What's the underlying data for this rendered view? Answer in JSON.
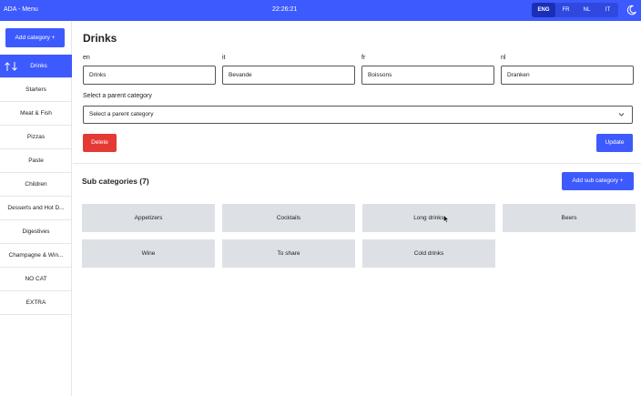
{
  "header": {
    "app_title": "ADA - Menu",
    "clock": "22:26:21",
    "languages": [
      "ENG",
      "FR",
      "NL",
      "IT"
    ],
    "active_language": "ENG",
    "theme_icon": "moon-icon"
  },
  "sidebar": {
    "add_label": "Add category +",
    "items": [
      {
        "label": "Drinks"
      },
      {
        "label": "Starters"
      },
      {
        "label": "Meat & Fish"
      },
      {
        "label": "Pizzas"
      },
      {
        "label": "Paste"
      },
      {
        "label": "Children"
      },
      {
        "label": "Desserts and Hot D..."
      },
      {
        "label": "Digestives"
      },
      {
        "label": "Champagne & Win..."
      },
      {
        "label": "NO CAT"
      },
      {
        "label": "EXTRA"
      }
    ]
  },
  "main": {
    "title": "Drinks",
    "fields": [
      {
        "lang": "en",
        "value": "Drinks"
      },
      {
        "lang": "it",
        "value": "Bevande"
      },
      {
        "lang": "fr",
        "value": "Boissons"
      },
      {
        "lang": "nl",
        "value": "Dranken"
      }
    ],
    "parent_label": "Select a parent category",
    "parent_placeholder": "Select a parent category",
    "delete_label": "Delete",
    "update_label": "Update",
    "sub_title": "Sub categories (7)",
    "add_sub_label": "Add sub category +",
    "subcategories": [
      "Appetizers",
      "Cocktails",
      "Long drinks",
      "Beers",
      "Wine",
      "To share",
      "Cold drinks"
    ]
  },
  "colors": {
    "accent": "#3d5afe",
    "danger": "#e53935",
    "tile": "#dde1e6"
  }
}
